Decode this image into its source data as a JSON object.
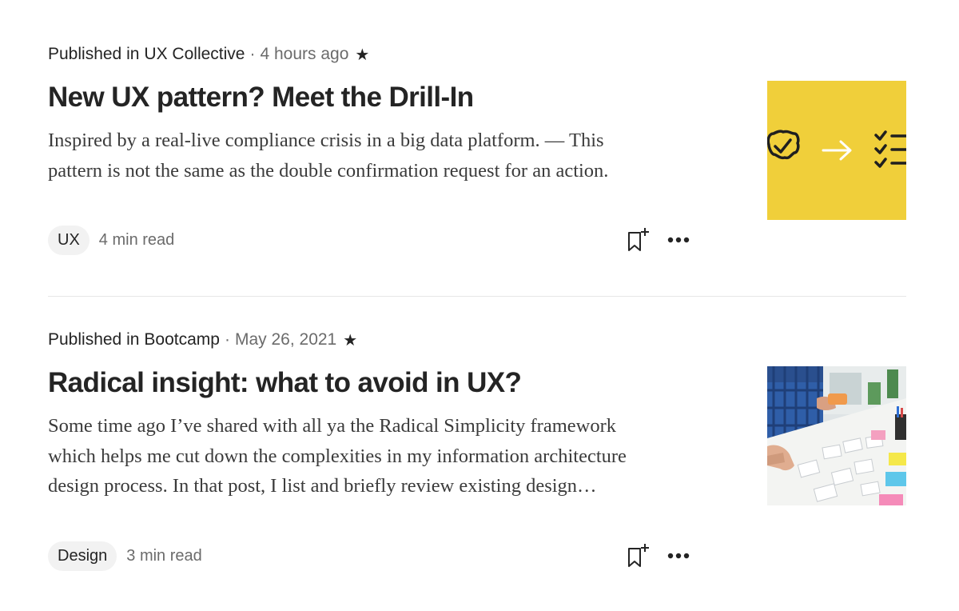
{
  "posts": [
    {
      "published_in_label": "Published in",
      "publication": "UX Collective",
      "separator": "·",
      "date": "4 hours ago",
      "star": "★",
      "title": "New UX pattern? Meet the Drill-In",
      "subtitle_lines": [
        "Inspired by a real-live compliance crisis in a big data platform. — This",
        "pattern is not the same as the double confirmation request for an action."
      ],
      "tag": "UX",
      "read_time": "4 min read",
      "thumbnail": {
        "kind": "illustration",
        "background": "#f0cf3a",
        "icons": [
          "badge-check-icon",
          "arrow-right-icon",
          "checklist-icon"
        ]
      }
    },
    {
      "published_in_label": "Published in",
      "publication": "Bootcamp",
      "separator": "·",
      "date": "May 26, 2021",
      "star": "★",
      "title": "Radical insight: what to avoid in UX?",
      "subtitle_lines": [
        "Some time ago I’ve shared with all ya the Radical Simplicity framework",
        "which helps me cut down the complexities in my information architecture",
        "design process. In that post, I list and briefly review existing design…"
      ],
      "tag": "Design",
      "read_time": "3 min read",
      "thumbnail": {
        "kind": "photo"
      }
    }
  ],
  "icons": {
    "save": "bookmark-add-icon",
    "more": "more-dots-icon"
  },
  "colors": {
    "text": "#242424",
    "muted": "#6b6b6b",
    "tag_bg": "#f2f2f2",
    "divider": "#e6e6e6"
  }
}
